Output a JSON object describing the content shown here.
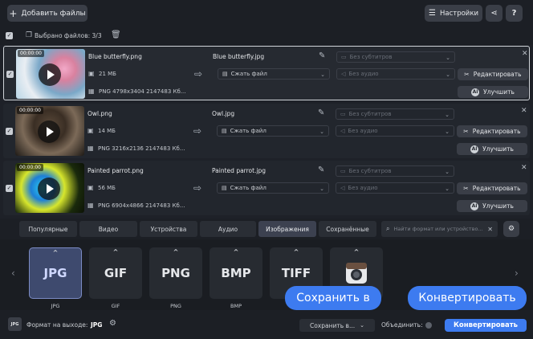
{
  "toolbar": {
    "add_files": "Добавить файлы",
    "settings": "Настройки",
    "help": "?"
  },
  "selection": {
    "label": "Выбрано файлов: 3/3"
  },
  "files": [
    {
      "timecode": "00:00:00",
      "input_name": "Blue butterfly.png",
      "size": "21 МБ",
      "info": "PNG 4798x3404 2147483 Кб...",
      "output_name": "Blue butterfly.jpg",
      "compress": "Сжать файл",
      "subtitles": "Без субтитров",
      "audio": "Без аудио",
      "edit": "Редактировать",
      "enhance": "Улучшить"
    },
    {
      "timecode": "00:00:00",
      "input_name": "Owl.png",
      "size": "14 МБ",
      "info": "PNG 3216x2136 2147483 Кб...",
      "output_name": "Owl.jpg",
      "compress": "Сжать файл",
      "subtitles": "Без субтитров",
      "audio": "Без аудио",
      "edit": "Редактировать",
      "enhance": "Улучшить"
    },
    {
      "timecode": "00:00:00",
      "input_name": "Painted parrot.png",
      "size": "56 МБ",
      "info": "PNG 6904x4866 2147483 Кб...",
      "output_name": "Painted parrot.jpg",
      "compress": "Сжать файл",
      "subtitles": "Без субтитров",
      "audio": "Без аудио",
      "edit": "Редактировать",
      "enhance": "Улучшить"
    }
  ],
  "tabs": [
    "Популярные",
    "Видео",
    "Устройства",
    "Аудио",
    "Изображения",
    "Сохранённые"
  ],
  "active_tab": "Изображения",
  "search": {
    "placeholder": "Найти формат или устройство..."
  },
  "formats": [
    {
      "label": "JPG",
      "caption": "JPG"
    },
    {
      "label": "GIF",
      "caption": "GIF"
    },
    {
      "label": "PNG",
      "caption": "PNG"
    },
    {
      "label": "BMP",
      "caption": "BMP"
    },
    {
      "label": "TIFF",
      "caption": ""
    },
    {
      "label": "",
      "caption": ""
    }
  ],
  "bottom": {
    "output_label": "Формат на выходе:",
    "output_value": "JPG",
    "save_to": "Сохранить в...",
    "merge": "Объединить:",
    "convert": "Конвертировать"
  },
  "tooltips": {
    "save": "Сохранить в",
    "convert": "Конвертировать"
  },
  "colors": {
    "accent": "#3d7bf0",
    "background": "#1e2128",
    "panel": "#22262d"
  }
}
